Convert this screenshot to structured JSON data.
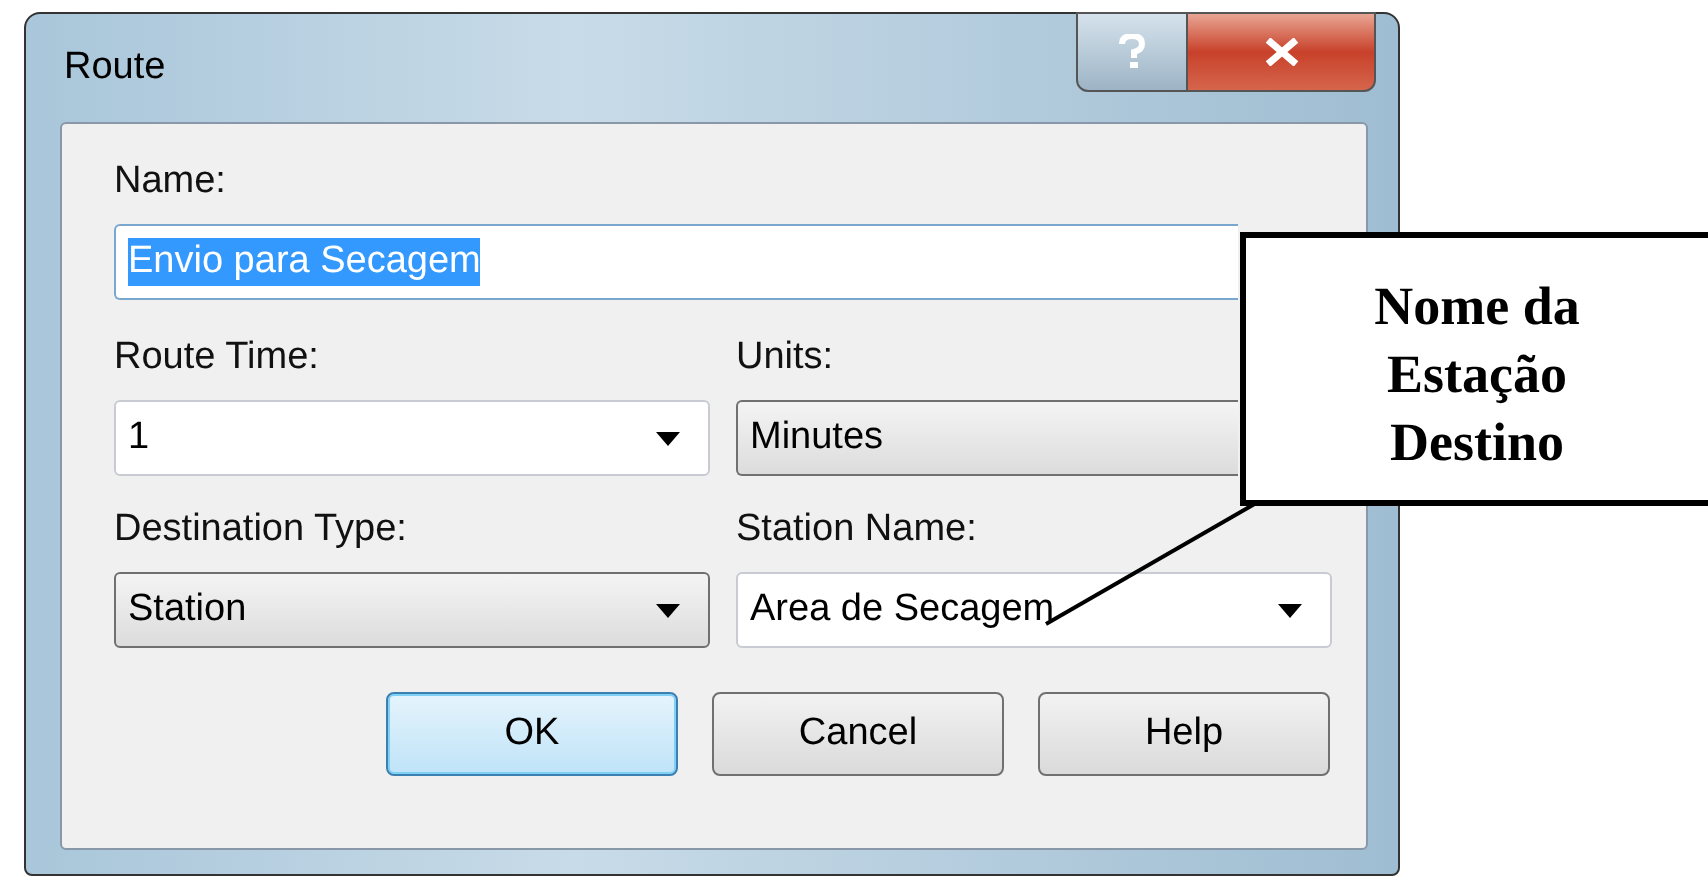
{
  "window": {
    "title": "Route"
  },
  "name_field": {
    "label": "Name:",
    "value": "Envio para Secagem",
    "text_selected": true
  },
  "fields": [
    {
      "label": "Route Time:",
      "value": "1",
      "kind": "editable",
      "arrow": true
    },
    {
      "label": "Units:",
      "value": "Minutes",
      "kind": "list",
      "arrow": false
    },
    {
      "label": "Destination Type:",
      "value": "Station",
      "kind": "list",
      "arrow": true
    },
    {
      "label": "Station Name:",
      "value": "Area de Secagem",
      "kind": "editable",
      "arrow": true
    }
  ],
  "buttons": [
    {
      "label": "OK",
      "default": true
    },
    {
      "label": "Cancel",
      "default": false
    },
    {
      "label": "Help",
      "default": false
    }
  ],
  "callout": {
    "lines": [
      "Nome da",
      "Estação",
      "Destino"
    ]
  }
}
